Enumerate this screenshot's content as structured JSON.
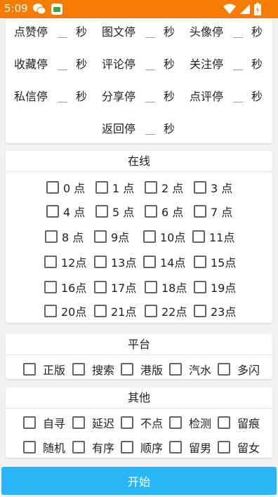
{
  "status_bar": {
    "time": "5:09",
    "icons_left": [
      "wechat-icon",
      "notification-app-icon"
    ],
    "icons_right": [
      "wifi-icon",
      "signal-icon",
      "battery-icon"
    ],
    "color": "#f57c00"
  },
  "stop_settings": {
    "unit": "秒",
    "items": [
      {
        "label": "点赞停",
        "value": ""
      },
      {
        "label": "图文停",
        "value": ""
      },
      {
        "label": "头像停",
        "value": ""
      },
      {
        "label": "收藏停",
        "value": ""
      },
      {
        "label": "评论停",
        "value": ""
      },
      {
        "label": "关注停",
        "value": ""
      },
      {
        "label": "私信停",
        "value": ""
      },
      {
        "label": "分享停",
        "value": ""
      },
      {
        "label": "点评停",
        "value": ""
      },
      {
        "label": "返回停",
        "value": ""
      }
    ]
  },
  "online": {
    "title": "在线",
    "hours": [
      "0 点",
      "1 点",
      "2 点",
      "3 点",
      "4 点",
      "5 点",
      "6 点",
      "7 点",
      "8 点",
      "9点",
      "10点",
      "11点",
      "12点",
      "13点",
      "14点",
      "15点",
      "16点",
      "17点",
      "18点",
      "19点",
      "20点",
      "21点",
      "22点",
      "23点"
    ]
  },
  "platform": {
    "title": "平台",
    "options": [
      "正版",
      "搜索",
      "港版",
      "汽水",
      "多闪"
    ]
  },
  "other": {
    "title": "其他",
    "options": [
      "自寻",
      "延迟",
      "不点",
      "检测",
      "留痕",
      "随机",
      "有序",
      "顺序",
      "留男",
      "留女"
    ]
  },
  "start_button": {
    "label": "开始",
    "color": "#29b6f6"
  }
}
